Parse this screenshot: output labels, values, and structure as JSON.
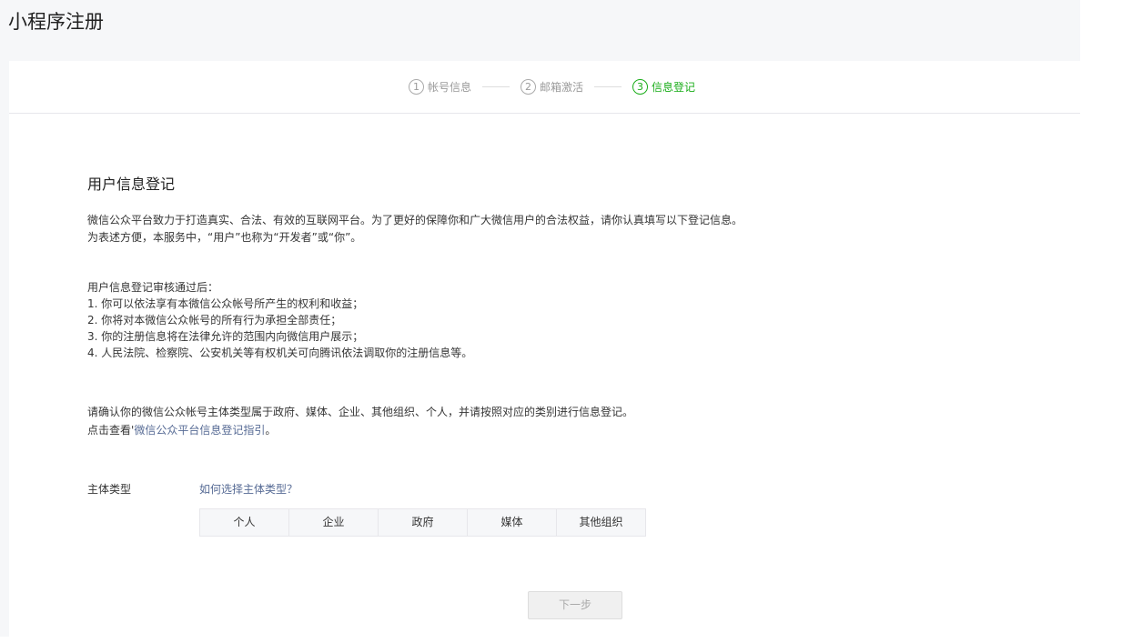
{
  "page_title": "小程序注册",
  "steps": [
    {
      "num": "1",
      "label": "帐号信息"
    },
    {
      "num": "2",
      "label": "邮箱激活"
    },
    {
      "num": "3",
      "label": "信息登记"
    }
  ],
  "section_title": "用户信息登记",
  "intro": [
    "微信公众平台致力于打造真实、合法、有效的互联网平台。为了更好的保障你和广大微信用户的合法权益，请你认真填写以下登记信息。",
    "为表述方便，本服务中，“用户”也称为“开发者”或“你”。"
  ],
  "after_review": [
    "用户信息登记审核通过后：",
    "1. 你可以依法享有本微信公众帐号所产生的权利和收益；",
    "2. 你将对本微信公众帐号的所有行为承担全部责任；",
    "3. 你的注册信息将在法律允许的范围内向微信用户展示；",
    "4. 人民法院、检察院、公安机关等有权机关可向腾讯依法调取你的注册信息等。"
  ],
  "confirm_text": "请确认你的微信公众帐号主体类型属于政府、媒体、企业、其他组织、个人，并请按照对应的类别进行信息登记。",
  "guide_prefix": "点击查看'",
  "guide_link": "微信公众平台信息登记指引",
  "guide_suffix": "。",
  "subject_label": "主体类型",
  "subject_help": "如何选择主体类型？",
  "subject_options": [
    "个人",
    "企业",
    "政府",
    "媒体",
    "其他组织"
  ],
  "next_button": "下一步"
}
